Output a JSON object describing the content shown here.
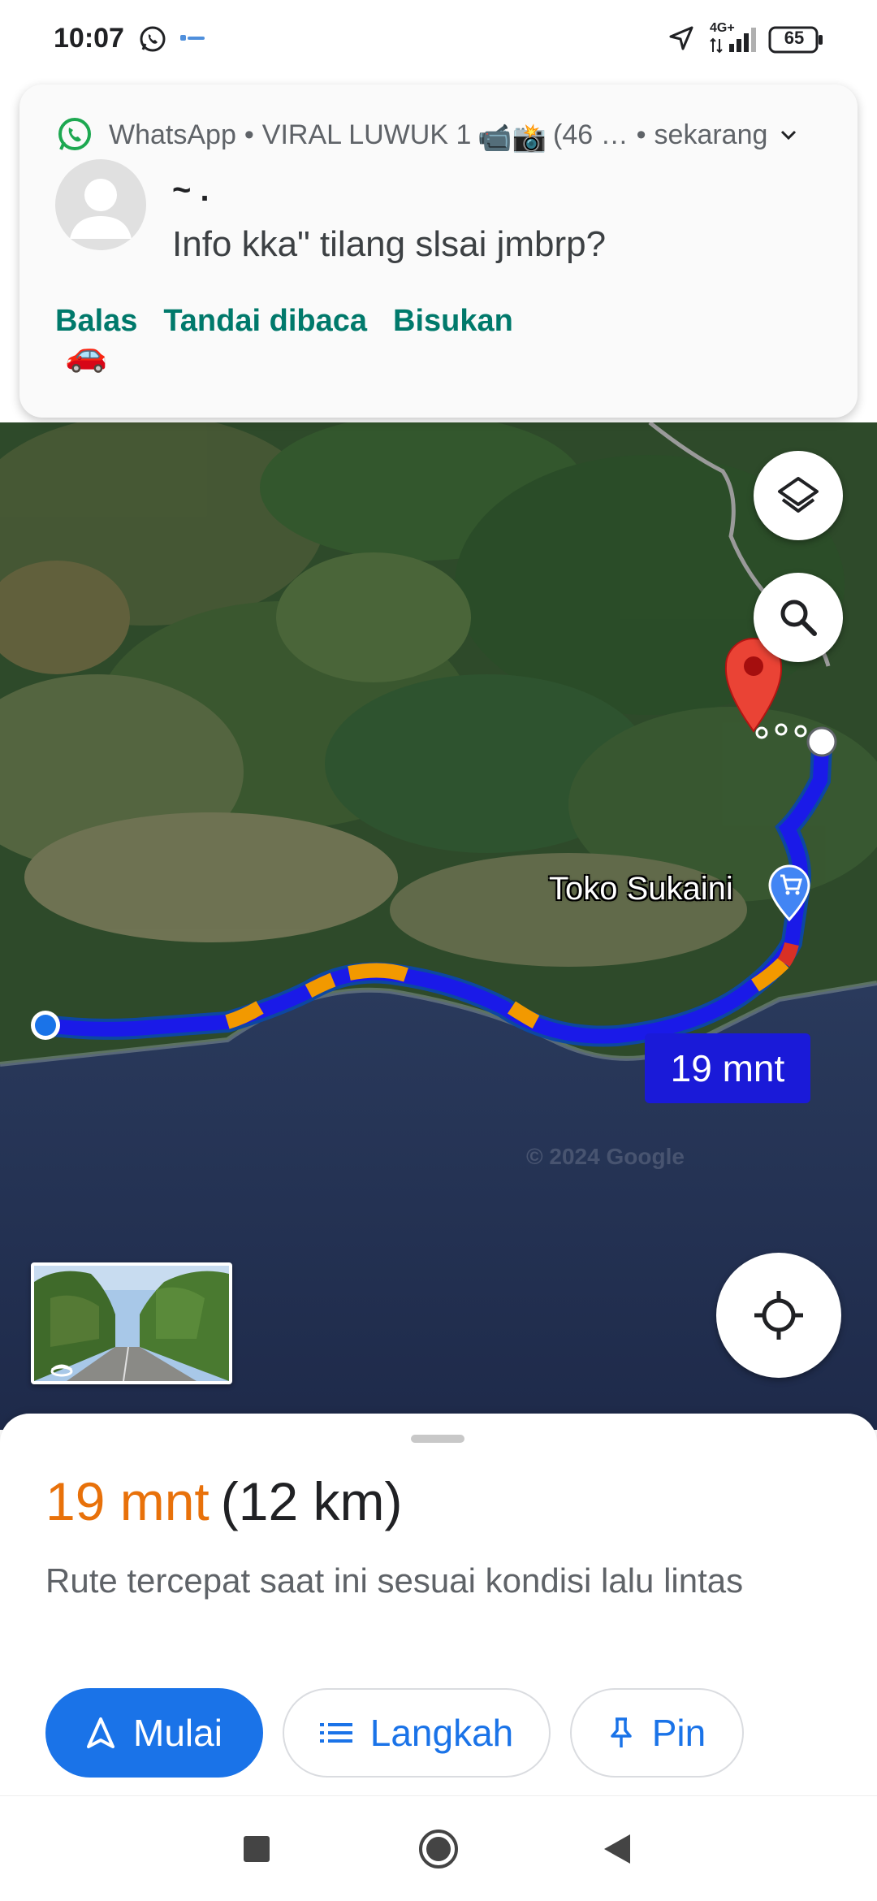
{
  "status_bar": {
    "time": "10:07",
    "network": "4G+",
    "battery": "65"
  },
  "notification": {
    "app": "WhatsApp",
    "group": "VIRAL LUWUK 1",
    "group_emojis": "📹📸",
    "count": "(46 …",
    "time": "sekarang",
    "header_sep": "•",
    "sender": "~ .",
    "message": "Info kka\" tilang slsai jmbrp?",
    "actions": [
      "Balas",
      "Tandai dibaca",
      "Bisukan"
    ]
  },
  "map": {
    "place_name": "Toko Sukaini",
    "route_eta": "19 mnt",
    "copyright": "© 2024 Google"
  },
  "sheet": {
    "duration": "19 mnt",
    "distance": "(12 km)",
    "description": "Rute tercepat saat ini sesuai kondisi lalu lintas",
    "start_label": "Mulai",
    "steps_label": "Langkah",
    "pin_label": "Pin"
  },
  "colors": {
    "accent_blue": "#1a73e8",
    "route_blue": "#1a1ae8",
    "duration_orange": "#e8710a",
    "whatsapp_green": "#25d366",
    "action_teal": "#00796b"
  },
  "icons": {
    "layers": "layers-icon",
    "search": "search-icon",
    "locate": "my-location-icon",
    "destination": "red-map-pin-icon",
    "shop": "shopping-cart-icon",
    "navigate": "navigation-arrow-icon",
    "steps": "list-icon",
    "pin": "pushpin-icon"
  }
}
